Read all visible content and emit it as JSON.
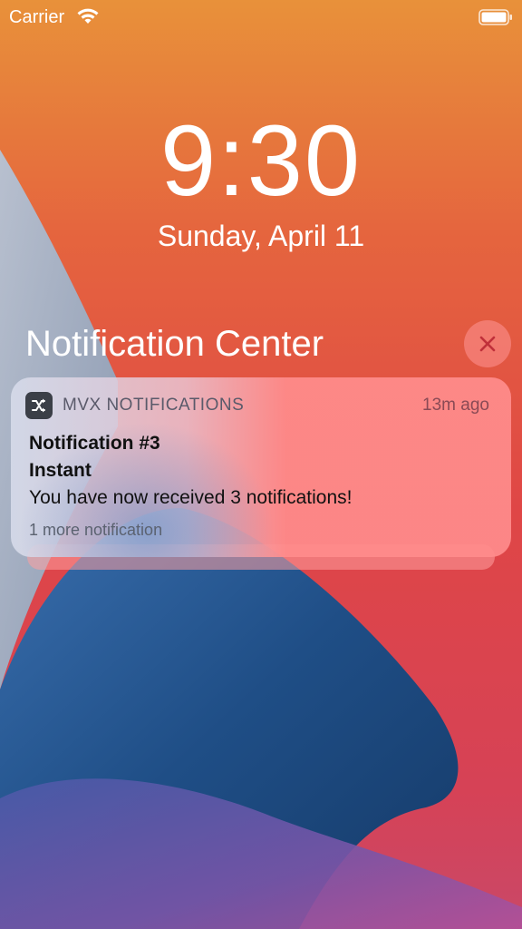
{
  "status_bar": {
    "carrier": "Carrier",
    "wifi_icon": "wifi-icon",
    "battery_icon": "battery-icon"
  },
  "lock_screen": {
    "time": "9:30",
    "date": "Sunday, April 11"
  },
  "notification_center": {
    "title": "Notification Center",
    "close_icon": "close-icon"
  },
  "notification": {
    "app_icon": "shuffle-icon",
    "app_name": "MVX NOTIFICATIONS",
    "timestamp": "13m ago",
    "title": "Notification #3",
    "subtitle": "Instant",
    "body": "You have now received 3 notifications!",
    "more": "1 more notification"
  },
  "colors": {
    "wallpaper_orange": "#e98c3c",
    "wallpaper_red": "#df4a44",
    "wallpaper_blue": "#2a5a9a",
    "wallpaper_purple": "#8a4aa0",
    "card_pink": "#ff8c8c",
    "app_icon_bg": "#3b3f47"
  }
}
